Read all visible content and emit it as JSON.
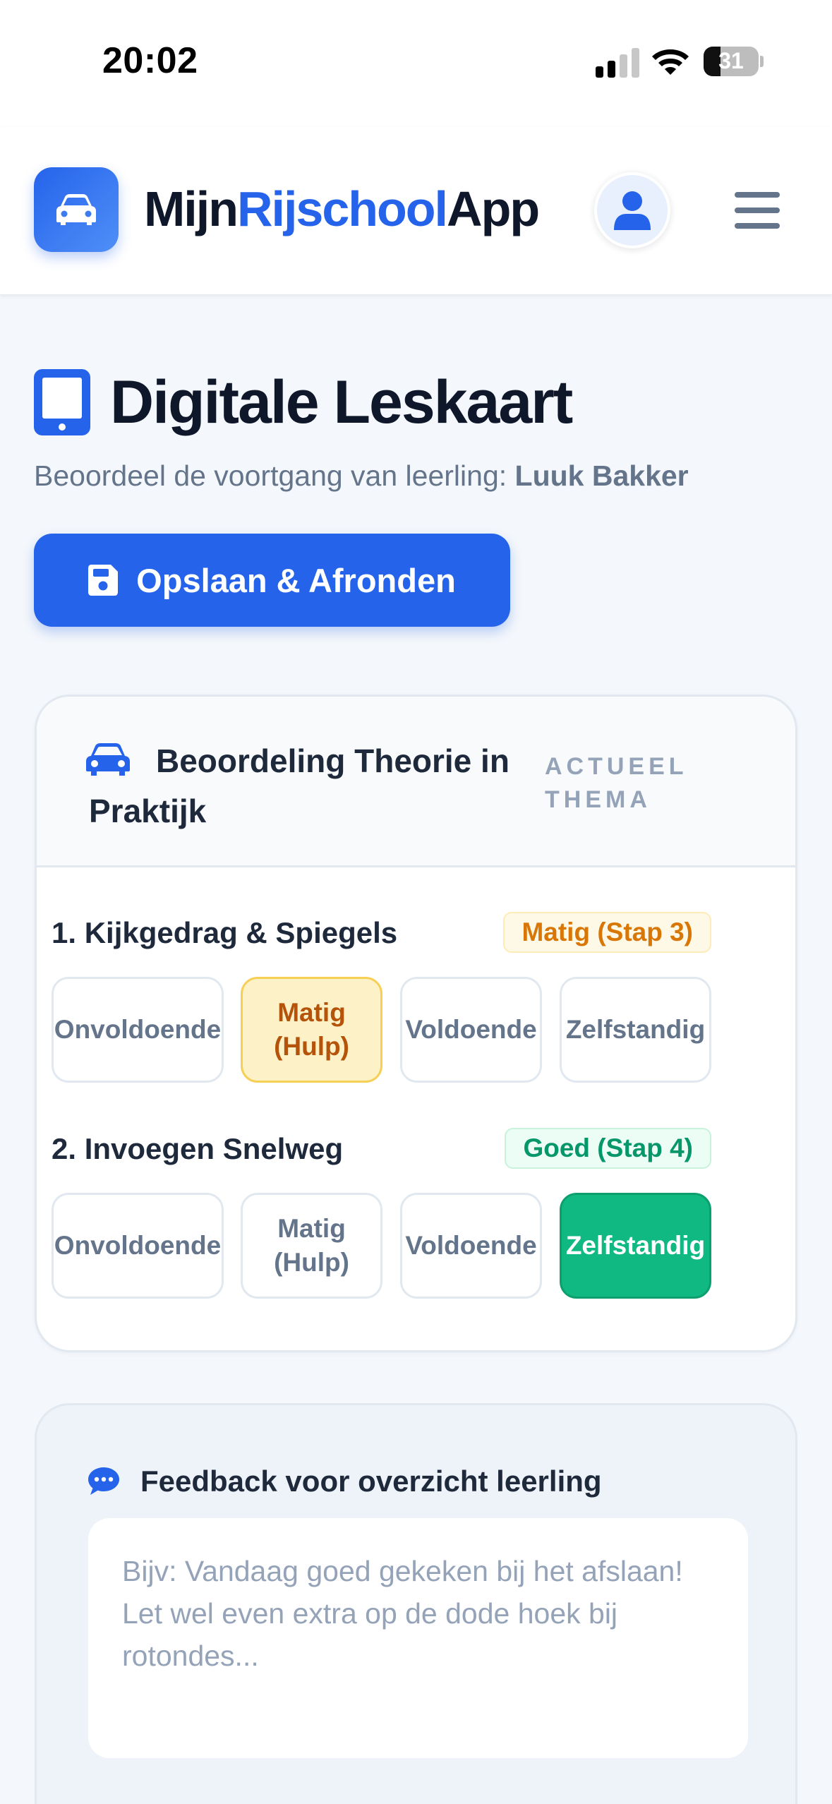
{
  "status_bar": {
    "time": "20:02",
    "battery": "31",
    "battery_level": 0.31
  },
  "header": {
    "brand_part1": "Mijn",
    "brand_part2": "Rijschool",
    "brand_part3": "App",
    "brand_accent_color": "#2563eb",
    "logo_icon": "car-icon",
    "profile_icon": "user-icon",
    "menu_icon": "hamburger-menu-icon"
  },
  "page": {
    "title_icon": "tablet-icon",
    "title": "Digitale Leskaart",
    "subtitle_prefix": "Beoordeel de voortgang van leerling: ",
    "student_name": "Luuk Bakker",
    "save_icon": "floppy-disk-icon",
    "save_label": "Opslaan & Afronden"
  },
  "rating_card": {
    "icon": "car-icon",
    "title": "Beoordeling Theorie in Praktijk",
    "tag": "ACTUEEL THEMA",
    "criteria": [
      {
        "label": "1. Kijkgedrag & Spiegels",
        "badge": "Matig (Stap 3)",
        "options": [
          "Onvoldoende",
          "Matig\n(Hulp)",
          "Voldoende",
          "Zelfstandig"
        ],
        "selected": "Matig (Hulp)"
      },
      {
        "label": "2. Invoegen Snelweg",
        "badge": "Goed (Stap 4)",
        "options": [
          "Onvoldoende",
          "Matig\n(Hulp)",
          "Voldoende",
          "Zelfstandig"
        ],
        "selected": "Zelfstandig"
      }
    ]
  },
  "feedback": {
    "icon": "chat-bubble-icon",
    "title": "Feedback voor overzicht leerling",
    "value": "",
    "placeholder": "Bijv: Vandaag goed gekeken bij het afslaan! Let wel even extra op de dode hoek bij rotondes..."
  },
  "colors": {
    "primary": "#2563eb",
    "amber": "#d97706",
    "green": "#10b981",
    "background": "#f4f7fb"
  }
}
